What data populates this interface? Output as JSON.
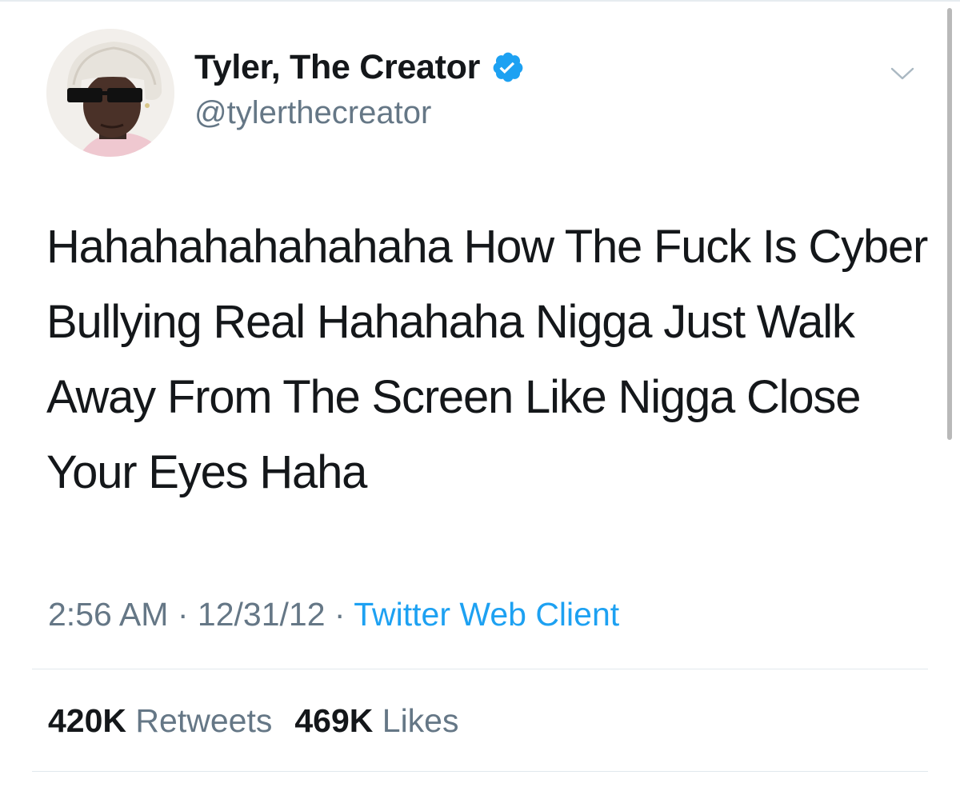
{
  "tweet": {
    "author": {
      "display_name": "Tyler, The Creator",
      "handle": "@tylerthecreator",
      "verified": true,
      "avatar_icon": "profile-photo"
    },
    "text": "Hahahahahahahaha How The Fuck Is Cyber Bullying Real Hahahaha Nigga Just Walk Away From The Screen Like Nigga Close Your Eyes Haha",
    "meta": {
      "time": "2:56 AM",
      "separator": "·",
      "date": "12/31/12",
      "source": "Twitter Web Client"
    },
    "stats": {
      "retweets_count": "420K",
      "retweets_label": "Retweets",
      "likes_count": "469K",
      "likes_label": "Likes"
    },
    "menu_icon": "chevron-down-icon"
  },
  "colors": {
    "verified_blue": "#1da1f2",
    "link_blue": "#1da1f2",
    "secondary_text": "#657786",
    "primary_text": "#14171a",
    "divider": "#e1e8ed"
  }
}
